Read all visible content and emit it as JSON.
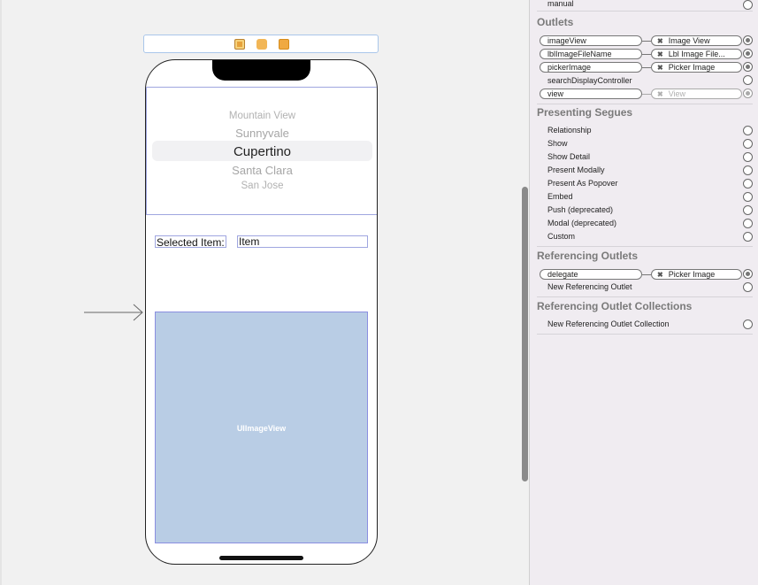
{
  "canvas": {
    "picker_items": [
      "Mountain View",
      "Sunnyvale",
      "Cupertino",
      "Santa Clara",
      "San Jose"
    ],
    "selected_item_label": "Selected Item:",
    "item_field_text": "Item",
    "image_view_label": "UIImageView",
    "dock_icons": [
      "view-controller-icon",
      "first-responder-icon",
      "exit-icon"
    ]
  },
  "inspector": {
    "top_row_label": "manual",
    "outlets_title": "Outlets",
    "outlets": [
      {
        "name": "imageView",
        "target": "Image View",
        "connected": true
      },
      {
        "name": "lblImageFileName",
        "target": "Lbl Image File...",
        "connected": true
      },
      {
        "name": "pickerImage",
        "target": "Picker Image",
        "connected": true
      },
      {
        "name": "searchDisplayController",
        "target": "",
        "connected": false
      },
      {
        "name": "view",
        "target": "View",
        "connected": true,
        "dimmed": true
      }
    ],
    "segues_title": "Presenting Segues",
    "segues": [
      "Relationship",
      "Show",
      "Show Detail",
      "Present Modally",
      "Present As Popover",
      "Embed",
      "Push (deprecated)",
      "Modal (deprecated)",
      "Custom"
    ],
    "ref_outlets_title": "Referencing Outlets",
    "ref_outlet": {
      "name": "delegate",
      "target": "Picker Image"
    },
    "new_ref_outlet": "New Referencing Outlet",
    "ref_collections_title": "Referencing Outlet Collections",
    "new_ref_collection": "New Referencing Outlet Collection",
    "colors": {
      "inspector_bg": "#f0ecf1",
      "image_view_fill": "#b9cde5",
      "selection_outline": "#9fa6e0"
    }
  }
}
